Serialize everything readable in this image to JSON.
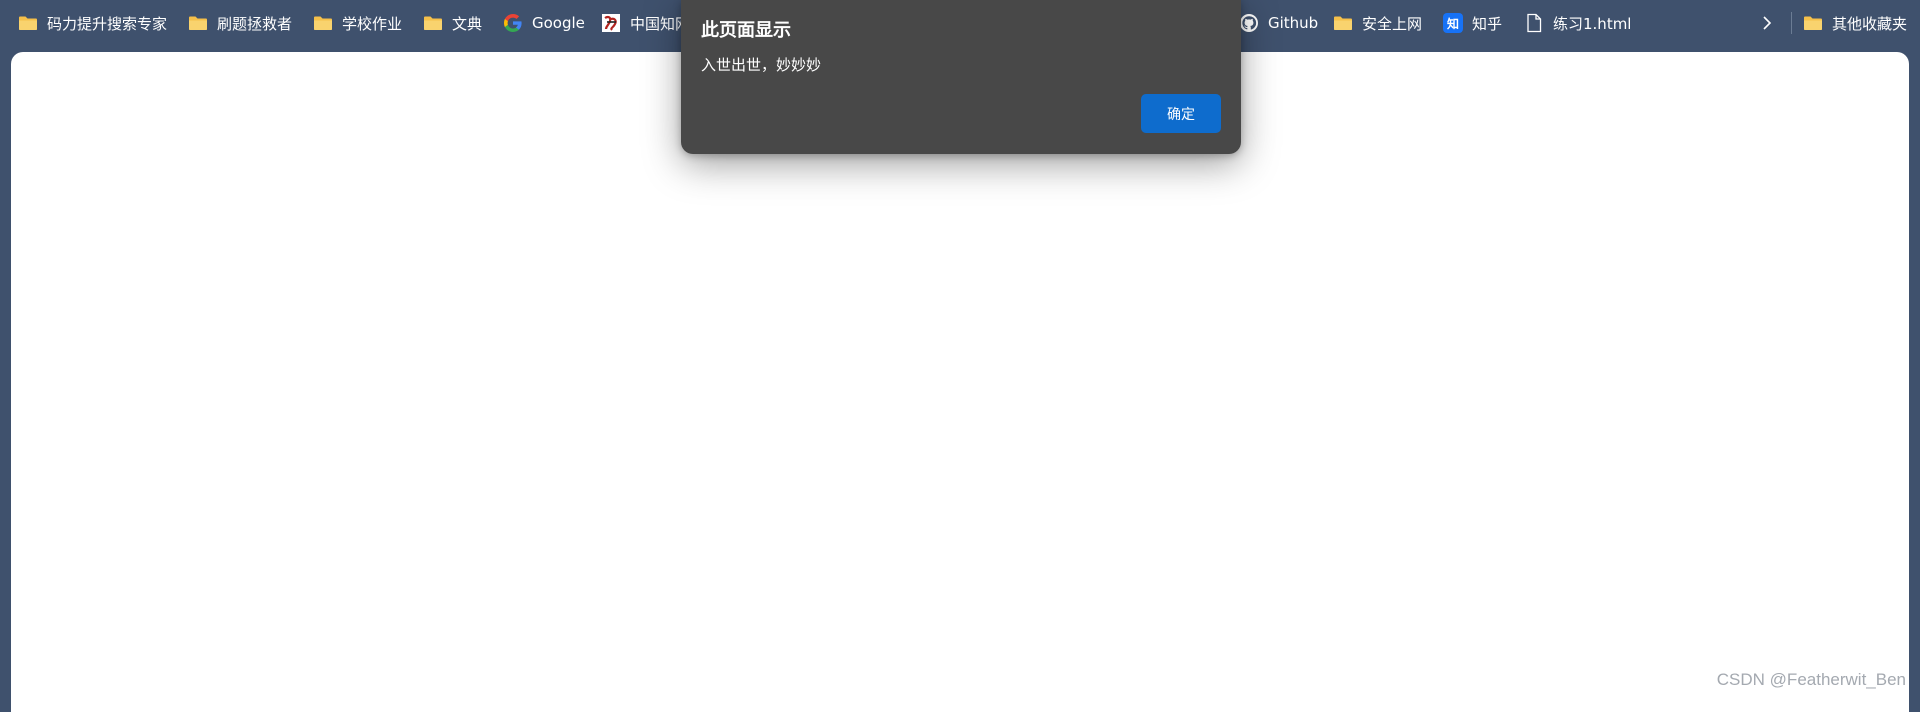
{
  "bookmarks": {
    "items": [
      {
        "label": "码力提升搜索专家",
        "icon": "folder-icon"
      },
      {
        "label": "刷题拯救者",
        "icon": "folder-icon"
      },
      {
        "label": "学校作业",
        "icon": "folder-icon"
      },
      {
        "label": "文典",
        "icon": "folder-icon"
      },
      {
        "label": "Google",
        "icon": "google-icon"
      },
      {
        "label": "中国知网",
        "icon": "cnki-icon"
      },
      {
        "label": "Github",
        "icon": "github-icon"
      },
      {
        "label": "安全上网",
        "icon": "folder-icon"
      },
      {
        "label": "知乎",
        "icon": "zhihu-icon",
        "badge": "知"
      },
      {
        "label": "练习1.html",
        "icon": "file-icon"
      }
    ],
    "more_icon": "chevron-right-icon",
    "other_bookmarks": {
      "label": "其他收藏夹",
      "icon": "folder-icon"
    }
  },
  "dialog": {
    "title": "此页面显示",
    "message": "入世出世，妙妙妙",
    "ok_label": "确定"
  },
  "watermark": "CSDN @Featherwit_Ben",
  "colors": {
    "toolbar_bg": "#3f516d",
    "dialog_bg": "#484848",
    "button_bg": "#0e6ccd",
    "folder": "#f5c04a",
    "zhihu": "#1772f6"
  }
}
